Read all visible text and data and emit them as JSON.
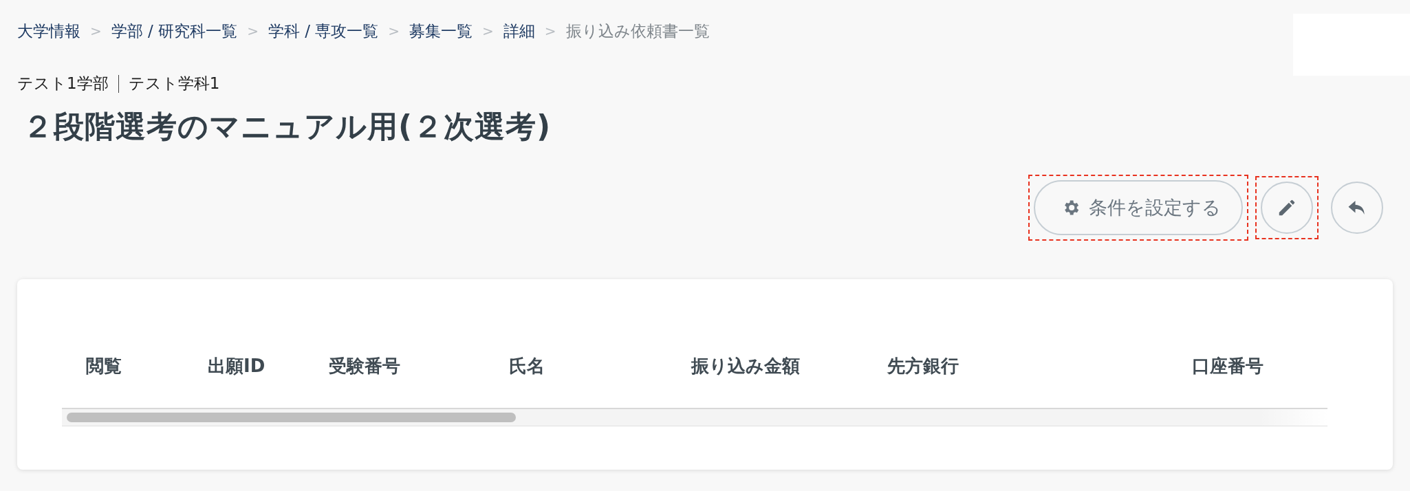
{
  "breadcrumbs": [
    {
      "label": "大学情報",
      "current": false
    },
    {
      "label": "学部 / 研究科一覧",
      "current": false
    },
    {
      "label": "学科 / 専攻一覧",
      "current": false
    },
    {
      "label": "募集一覧",
      "current": false
    },
    {
      "label": "詳細",
      "current": false
    },
    {
      "label": "振り込み依頼書一覧",
      "current": true
    }
  ],
  "breadcrumb_separator": ">",
  "subtitle": {
    "faculty": "テスト1学部",
    "department": "テスト学科1"
  },
  "title": "２段階選考のマニュアル用(２次選考)",
  "actions": [
    {
      "kind": "settings",
      "label": "条件を設定する",
      "highlighted": true
    },
    {
      "kind": "edit",
      "highlighted": true
    },
    {
      "kind": "back",
      "highlighted": false
    }
  ],
  "table": {
    "columns": [
      "閲覧",
      "出願ID",
      "受験番号",
      "氏名",
      "振り込み金額",
      "先方銀行",
      "口座番号"
    ]
  }
}
